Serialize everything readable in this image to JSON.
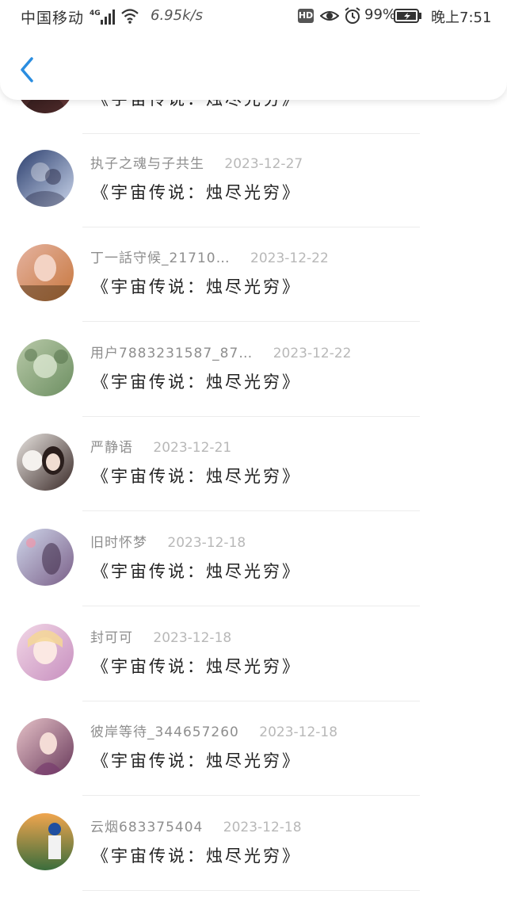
{
  "status_bar": {
    "carrier": "中国移动",
    "network": "4G",
    "speed": "6.95k/s",
    "hd_label": "HD",
    "battery": "99%",
    "time": "晚上7:51"
  },
  "header": {
    "back_icon": "chevron-left-icon",
    "accent_color": "#2a8de0"
  },
  "items": [
    {
      "user": "",
      "date": "",
      "comment": "《宇宙传说：烛尽光穷》",
      "avatar_colors": [
        "#2c1a1a",
        "#6b3a3a"
      ]
    },
    {
      "user": "执子之魂与子共生",
      "date": "2023-12-27",
      "comment": "《宇宙传说：烛尽光穷》",
      "avatar_colors": [
        "#2c3f6e",
        "#c9d4ea"
      ]
    },
    {
      "user": "丁一話守候_21710…",
      "date": "2023-12-22",
      "comment": "《宇宙传说：烛尽光穷》",
      "avatar_colors": [
        "#e5b3a0",
        "#c7773e"
      ]
    },
    {
      "user": "用户7883231587_87…",
      "date": "2023-12-22",
      "comment": "《宇宙传说：烛尽光穷》",
      "avatar_colors": [
        "#b8c9a8",
        "#6d8f62"
      ]
    },
    {
      "user": "严静语",
      "date": "2023-12-21",
      "comment": "《宇宙传说：烛尽光穷》",
      "avatar_colors": [
        "#e8e4e0",
        "#3a2a28"
      ]
    },
    {
      "user": "旧时怀梦",
      "date": "2023-12-18",
      "comment": "《宇宙传说：烛尽光穷》",
      "avatar_colors": [
        "#cfd6ea",
        "#7a5f88"
      ]
    },
    {
      "user": "封可可",
      "date": "2023-12-18",
      "comment": "《宇宙传说：烛尽光穷》",
      "avatar_colors": [
        "#f2d7e6",
        "#c78fbf"
      ]
    },
    {
      "user": "彼岸等待_344657260",
      "date": "2023-12-18",
      "comment": "《宇宙传说：烛尽光穷》",
      "avatar_colors": [
        "#e6c2c8",
        "#6a3b5c"
      ]
    },
    {
      "user": "云烟683375404",
      "date": "2023-12-18",
      "comment": "《宇宙传说：烛尽光穷》",
      "avatar_colors": [
        "#f0a54e",
        "#3a6d3c"
      ]
    }
  ]
}
